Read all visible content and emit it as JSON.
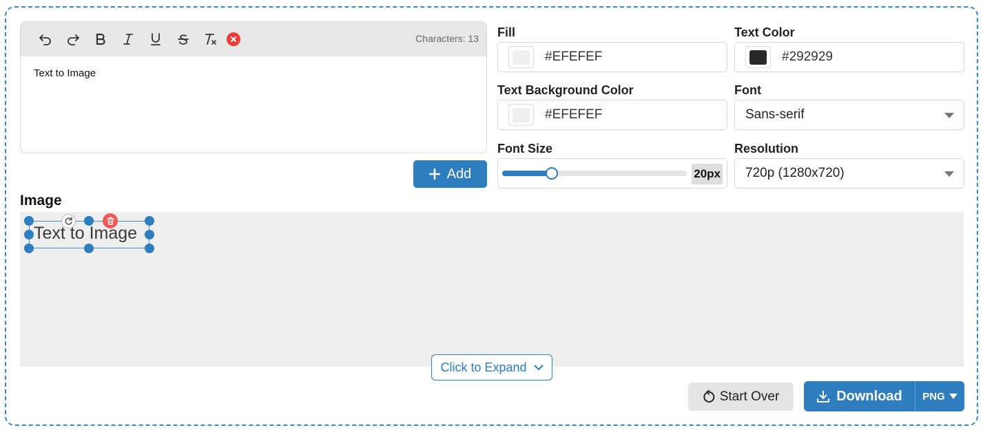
{
  "editor": {
    "char_count": "Characters: 13",
    "text": "Text to Image",
    "toolbar": [
      "undo-icon",
      "redo-icon",
      "bold-icon",
      "italic-icon",
      "underline-icon",
      "strikethrough-icon",
      "clear-format-icon",
      "close-icon"
    ]
  },
  "add_button": {
    "label": "Add",
    "icon": "plus-icon"
  },
  "fill": {
    "label": "Fill",
    "value": "#EFEFEF",
    "color": "#EFEFEF"
  },
  "text_color": {
    "label": "Text Color",
    "value": "#292929",
    "color": "#292929"
  },
  "text_bg": {
    "label": "Text Background Color",
    "value": "#EFEFEF",
    "color": "#EFEFEF"
  },
  "font": {
    "label": "Font",
    "value": "Sans-serif"
  },
  "font_size": {
    "label": "Font Size",
    "value": "20px",
    "fraction": 0.27
  },
  "resolution": {
    "label": "Resolution",
    "value": "720p (1280x720)"
  },
  "image": {
    "heading": "Image",
    "text_object": "Text to Image",
    "expand_label": "Click to Expand"
  },
  "actions": {
    "start_over": "Start Over",
    "download": "Download",
    "format": "PNG"
  },
  "colors": {
    "accent": "#2D7DBF",
    "delete": "#EE3B3B"
  }
}
